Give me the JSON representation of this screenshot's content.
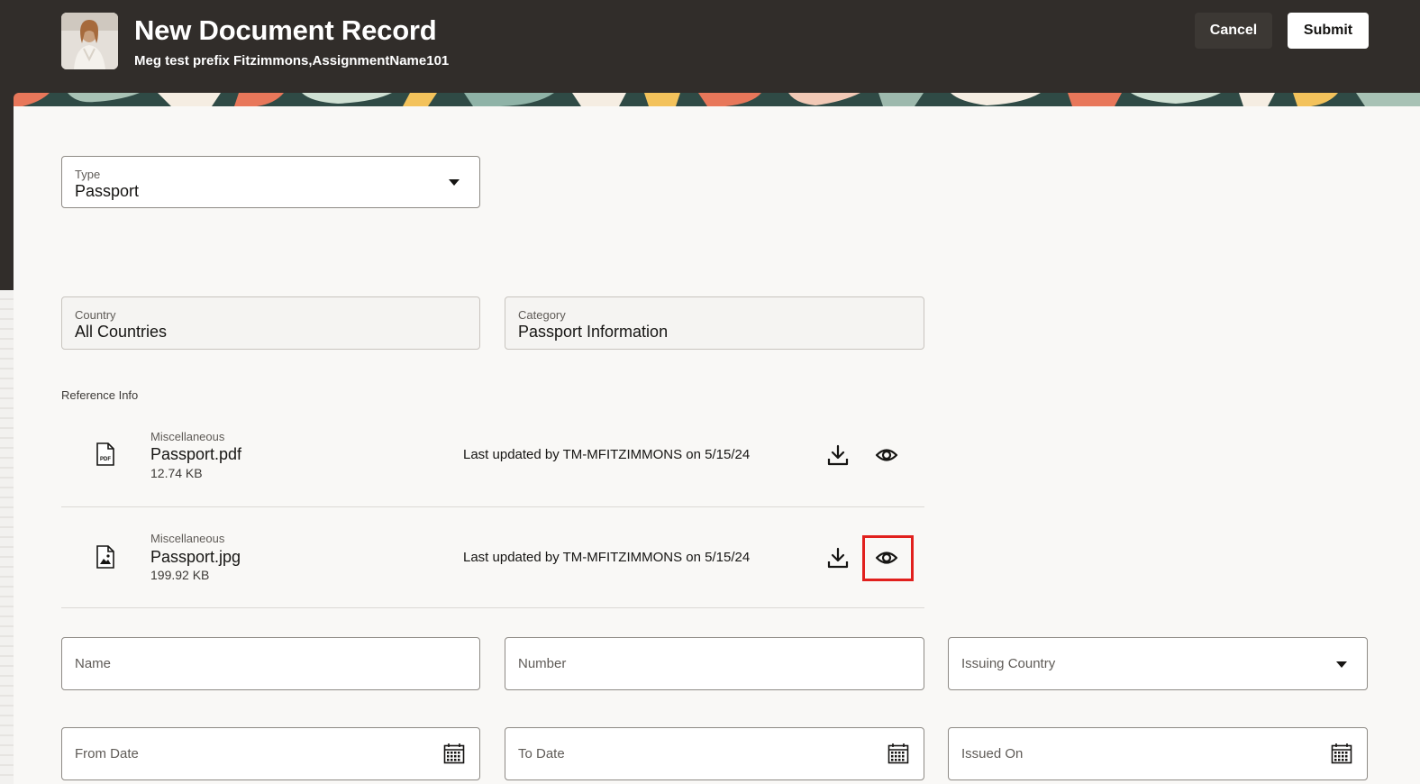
{
  "header": {
    "title": "New Document Record",
    "subtitle": "Meg test prefix Fitzimmons,AssignmentName101",
    "cancel_label": "Cancel",
    "submit_label": "Submit"
  },
  "form": {
    "type": {
      "label": "Type",
      "value": "Passport"
    },
    "country": {
      "label": "Country",
      "value": "All Countries"
    },
    "category": {
      "label": "Category",
      "value": "Passport Information"
    },
    "reference_info_label": "Reference Info"
  },
  "files": [
    {
      "category": "Miscellaneous",
      "name": "Passport.pdf",
      "size": "12.74 KB",
      "updated": "Last updated by TM-MFITZIMMONS on 5/15/24",
      "icon": "pdf-file-icon"
    },
    {
      "category": "Miscellaneous",
      "name": "Passport.jpg",
      "size": "199.92 KB",
      "updated": "Last updated by TM-MFITZIMMONS on 5/15/24",
      "icon": "image-file-icon"
    }
  ],
  "fields": {
    "name": "Name",
    "number": "Number",
    "issuing_country": "Issuing Country",
    "from_date": "From Date",
    "to_date": "To Date",
    "issued_on": "Issued On"
  },
  "colors": {
    "header_bg": "#312d2a",
    "panel_bg": "#f9f8f6",
    "highlight": "#e1201d"
  }
}
